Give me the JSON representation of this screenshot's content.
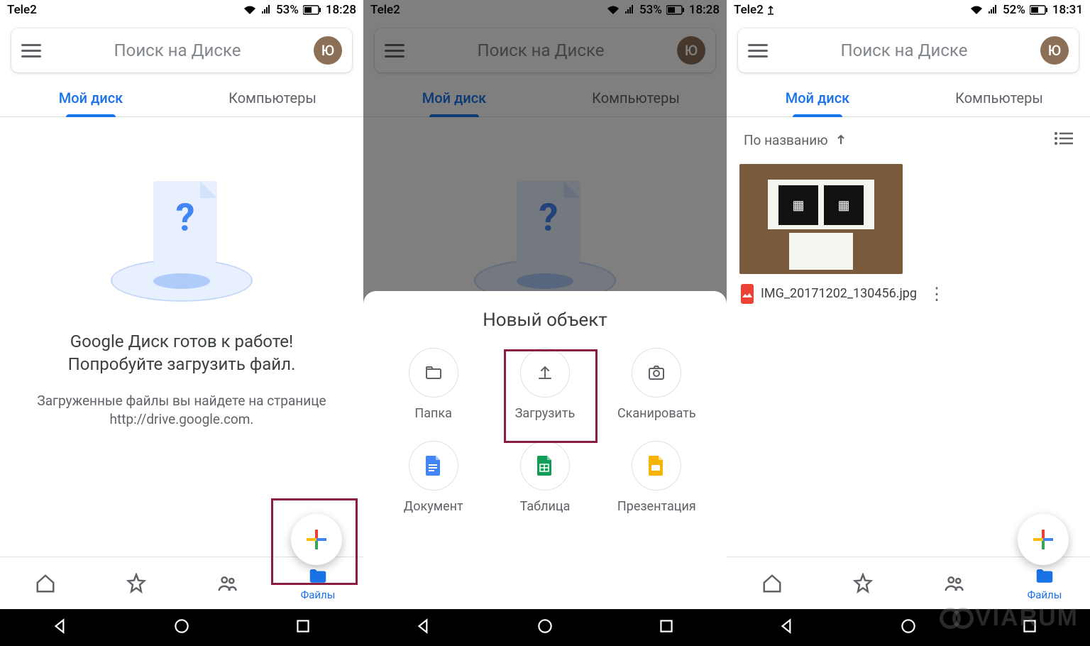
{
  "panel1": {
    "status": {
      "carrier": "Tele2",
      "battery": "53%",
      "time": "18:28"
    },
    "search_placeholder": "Поиск на Диске",
    "avatar_initial": "Ю",
    "tabs": {
      "mydrive": "Мой диск",
      "computers": "Компьютеры"
    },
    "empty": {
      "title_l1": "Google Диск готов к работе!",
      "title_l2": "Попробуйте загрузить файл.",
      "sub": "Загруженные файлы вы найдете на странице http://drive.google.com."
    },
    "nav": {
      "files": "Файлы"
    }
  },
  "panel2": {
    "status": {
      "carrier": "Tele2",
      "battery": "53%",
      "time": "18:28"
    },
    "search_placeholder": "Поиск на Диске",
    "avatar_initial": "Ю",
    "tabs": {
      "mydrive": "Мой диск",
      "computers": "Компьютеры"
    },
    "sheet_title": "Новый объект",
    "actions": {
      "folder": "Папка",
      "upload": "Загрузить",
      "scan": "Сканировать",
      "doc": "Документ",
      "sheet": "Таблица",
      "slides": "Презентация"
    }
  },
  "panel3": {
    "status": {
      "carrier": "Tele2",
      "battery": "52%",
      "time": "18:31"
    },
    "search_placeholder": "Поиск на Диске",
    "avatar_initial": "Ю",
    "tabs": {
      "mydrive": "Мой диск",
      "computers": "Компьютеры"
    },
    "sort_label": "По названию",
    "file": {
      "name": "IMG_20171202_130456.jpg"
    },
    "nav": {
      "files": "Файлы"
    }
  },
  "watermark": "VIARUM"
}
